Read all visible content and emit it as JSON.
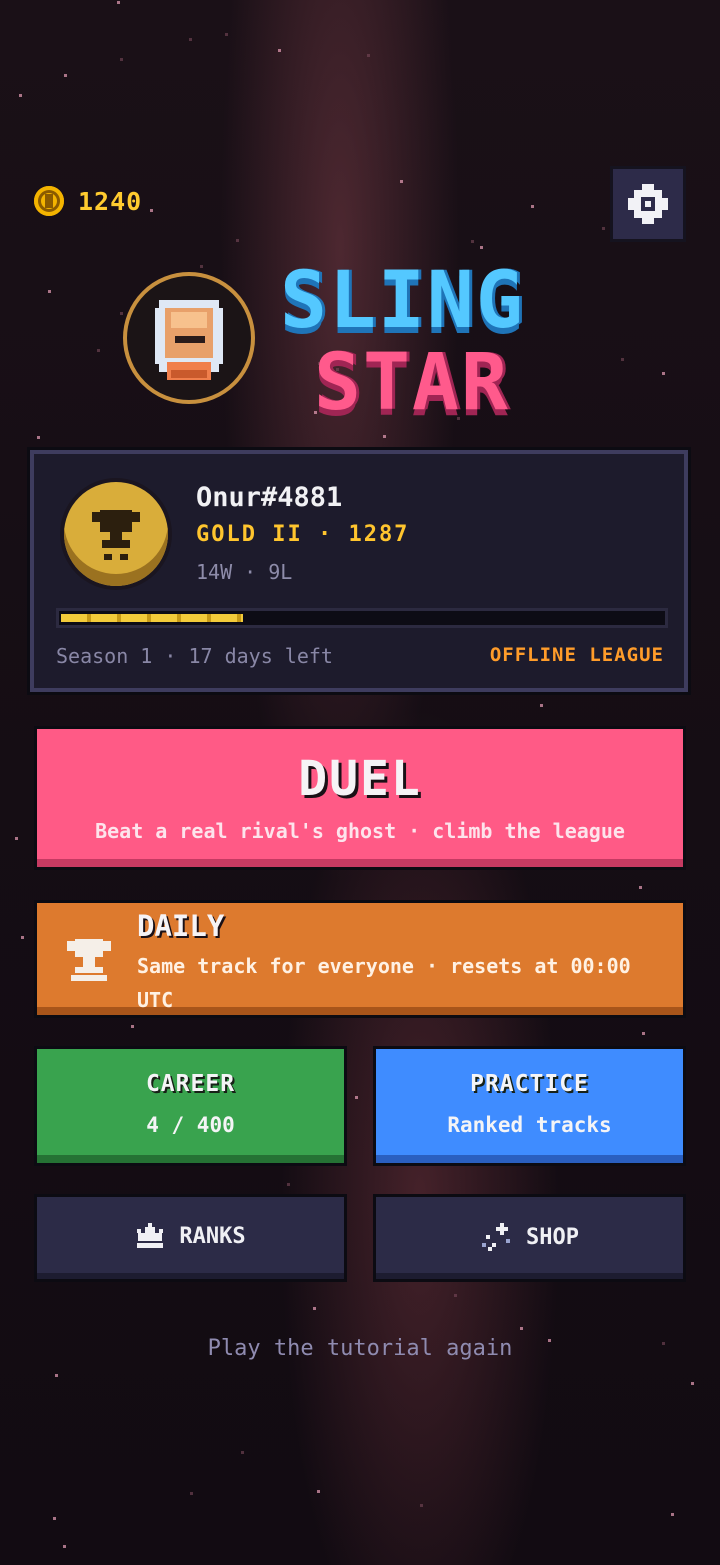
{
  "header": {
    "coin_count": "1240",
    "coin_icon": "coin-icon",
    "settings_icon": "gear-icon"
  },
  "logo": {
    "line1": "SLING",
    "line2": "STAR",
    "colors": {
      "line1": "#54c8ff",
      "line2": "#ff5a8c"
    }
  },
  "profile": {
    "name": "Onur#4881",
    "rank": "GOLD II · 1287",
    "record": "14W · 9L",
    "progress": 0.3,
    "season": "Season 1 · 17 days left",
    "league": "OFFLINE LEAGUE",
    "badge_icon": "trophy-icon"
  },
  "modes": {
    "duel": {
      "title": "DUEL",
      "subtitle": "Beat a real rival's ghost · climb the league",
      "color": "#ff5a86"
    },
    "daily": {
      "title": "DAILY",
      "subtitle": "Same track for everyone · resets at 00:00 UTC",
      "icon": "trophy-icon",
      "color": "#dd7a2e"
    },
    "career": {
      "title": "CAREER",
      "subtitle": "4 / 400",
      "color": "#39a34e"
    },
    "practice": {
      "title": "PRACTICE",
      "subtitle": "Ranked tracks",
      "color": "#3f8cff"
    },
    "ranks": {
      "label": "RANKS",
      "icon": "crown-icon"
    },
    "shop": {
      "label": "SHOP",
      "icon": "sparkle-icon"
    }
  },
  "footer": {
    "tutorial_link": "Play the tutorial again"
  }
}
